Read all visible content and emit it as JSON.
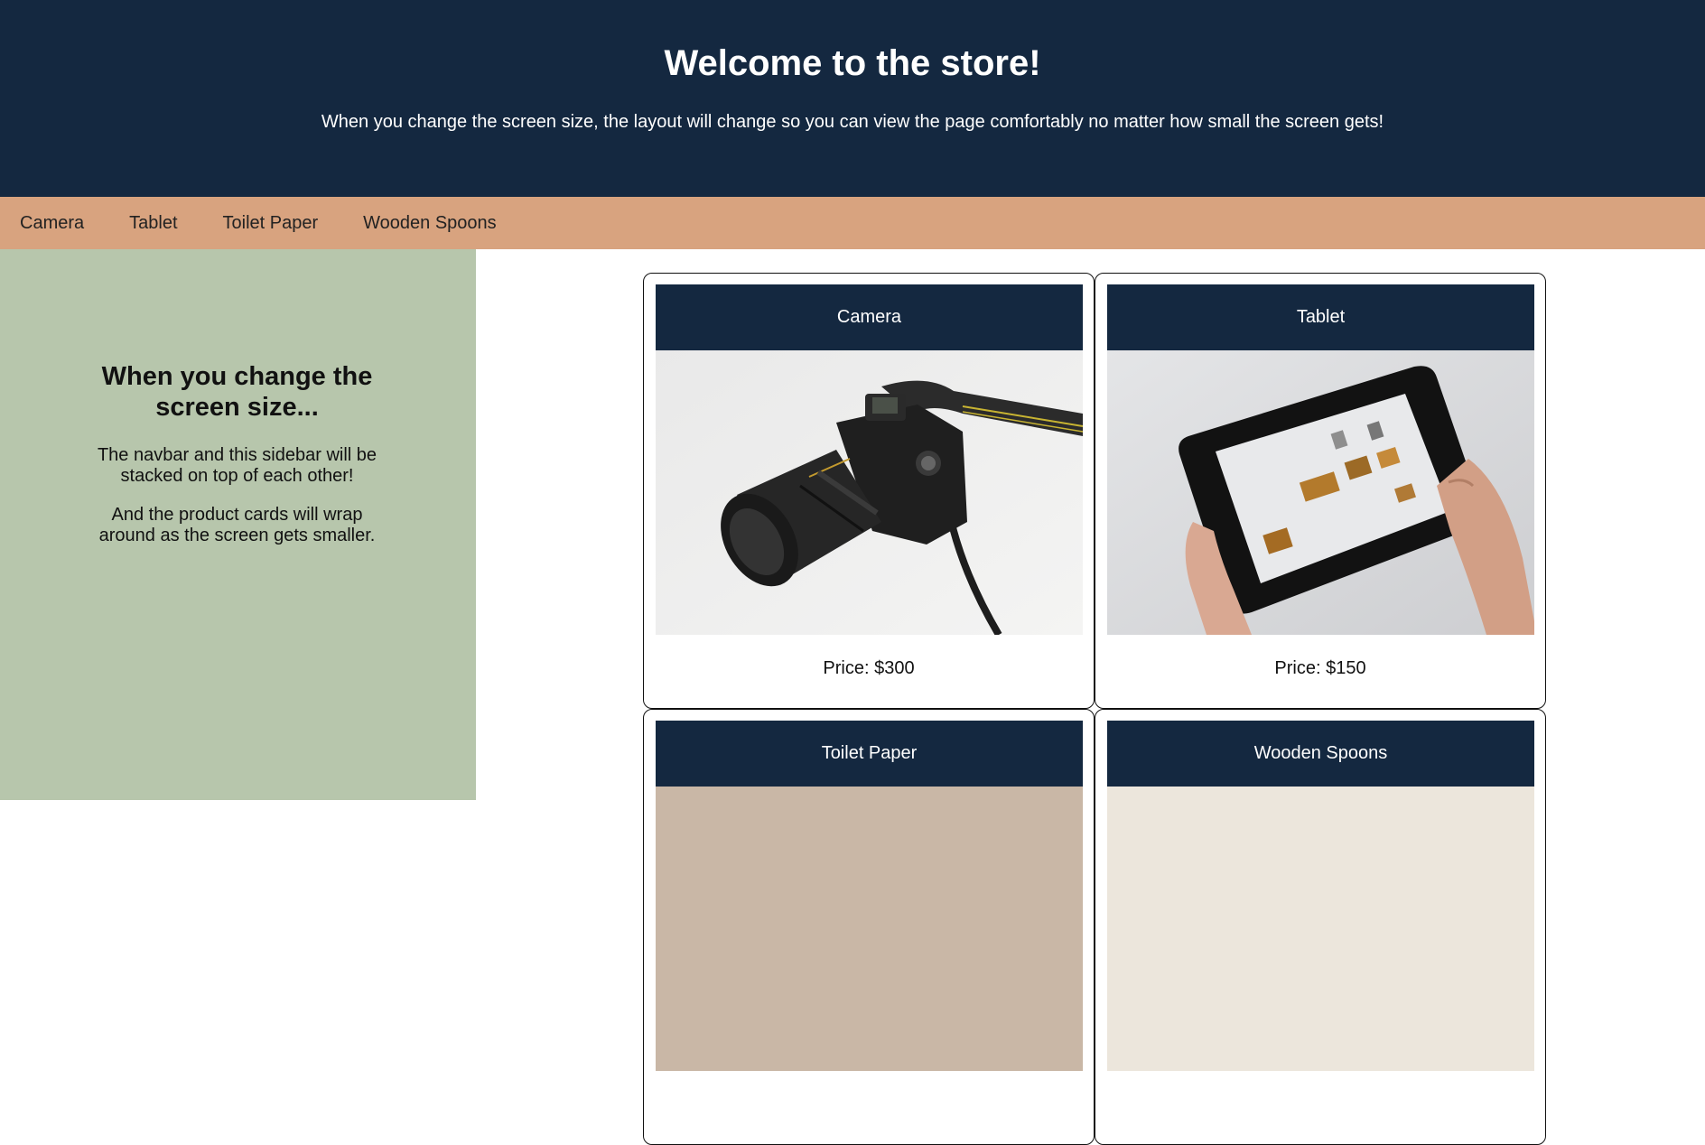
{
  "header": {
    "title": "Welcome to the store!",
    "subtitle": "When you change the screen size, the layout will change so you can view the page comfortably no matter how small the screen gets!"
  },
  "nav": {
    "items": [
      "Camera",
      "Tablet",
      "Toilet Paper",
      "Wooden Spoons"
    ]
  },
  "sidebar": {
    "heading": "When you change the screen size...",
    "paragraph1": "The navbar and this sidebar will be stacked on top of each other!",
    "paragraph2": "And the product cards will wrap around as the screen gets smaller."
  },
  "products": [
    {
      "name": "Camera",
      "price": "Price: $300"
    },
    {
      "name": "Tablet",
      "price": "Price: $150"
    },
    {
      "name": "Toilet Paper",
      "price": ""
    },
    {
      "name": "Wooden Spoons",
      "price": ""
    }
  ],
  "colors": {
    "header_bg": "#142840",
    "nav_bg": "#d8a37f",
    "sidebar_bg": "#b7c6ac"
  }
}
